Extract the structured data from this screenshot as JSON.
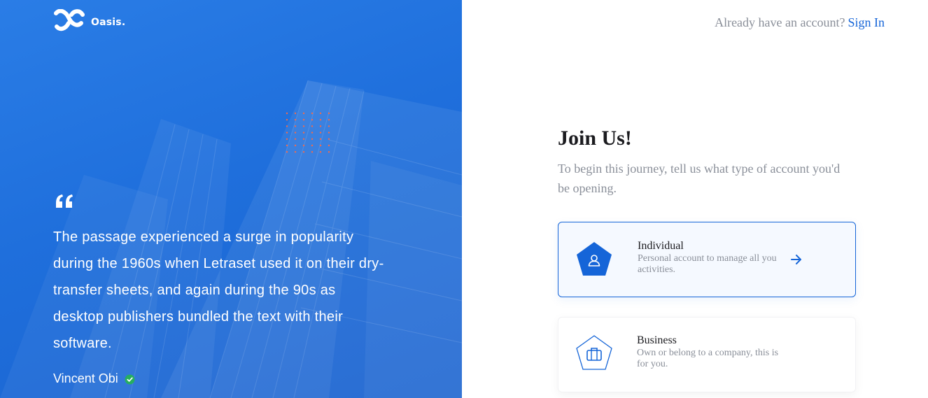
{
  "brand": {
    "name": "Oasis."
  },
  "left_panel": {
    "quote": "The passage experienced a surge in popularity during the 1960s when Letraset used it on their dry-transfer sheets, and again during the 90s as desktop publishers bundled the text with their software.",
    "author": "Vincent Obi",
    "icons": {
      "quote": "quote-icon",
      "verified": "check-circle-icon"
    },
    "colors": {
      "panel": "#1f6fdc",
      "verified": "#27ae60",
      "dots": "#f06a4e"
    }
  },
  "header": {
    "signin_prompt": "Already have an account?",
    "signin_link": "Sign In"
  },
  "main": {
    "title": "Join Us!",
    "subtitle": "To begin this journey, tell us what type of account you'd be opening.",
    "cards": [
      {
        "title": "Individual",
        "description": "Personal account to manage all you activities.",
        "icon": "user-icon",
        "selected": true
      },
      {
        "title": "Business",
        "description": "Own or belong to a company, this is for you.",
        "icon": "briefcase-icon",
        "selected": false
      }
    ]
  },
  "colors": {
    "accent": "#1565d8",
    "muted_text": "#8a8f99"
  }
}
